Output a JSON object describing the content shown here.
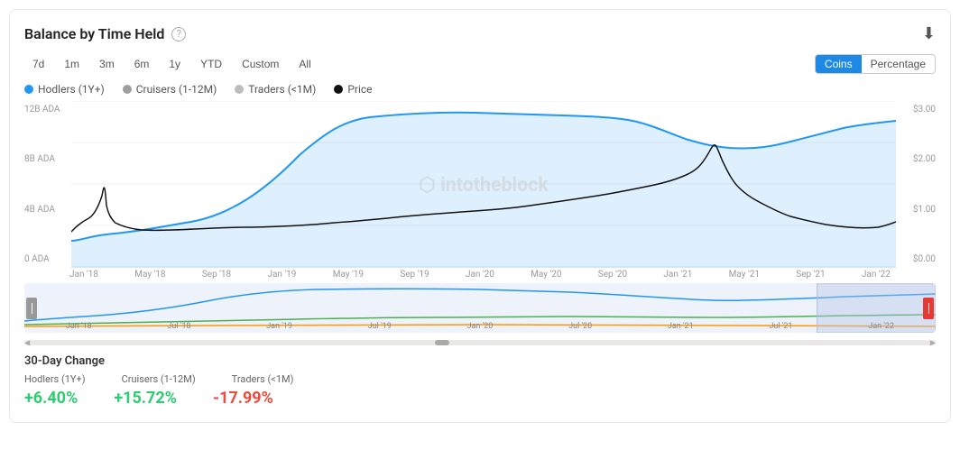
{
  "card": {
    "title": "Balance by Time Held",
    "download_label": "⬇"
  },
  "time_buttons": [
    {
      "label": "7d",
      "id": "7d"
    },
    {
      "label": "1m",
      "id": "1m"
    },
    {
      "label": "3m",
      "id": "3m"
    },
    {
      "label": "6m",
      "id": "6m"
    },
    {
      "label": "1y",
      "id": "1y"
    },
    {
      "label": "YTD",
      "id": "ytd"
    },
    {
      "label": "Custom",
      "id": "custom"
    },
    {
      "label": "All",
      "id": "all"
    }
  ],
  "view_toggle": {
    "coins_label": "Coins",
    "percentage_label": "Percentage"
  },
  "legend": [
    {
      "label": "Hodlers (1Y+)",
      "color": "#2196F3"
    },
    {
      "label": "Cruisers (1-12M)",
      "color": "#9E9E9E"
    },
    {
      "label": "Traders (<1M)",
      "color": "#BDBDBD"
    },
    {
      "label": "Price",
      "color": "#111"
    }
  ],
  "y_axis_left": [
    "12B ADA",
    "8B ADA",
    "4B ADA",
    "0 ADA"
  ],
  "y_axis_right": [
    "$3.00",
    "$2.00",
    "$1.00",
    "$0.00"
  ],
  "x_axis": [
    "Jan '18",
    "May '18",
    "Sep '18",
    "Jan '19",
    "May '19",
    "Sep '19",
    "Jan '20",
    "May '20",
    "Sep '20",
    "Jan '21",
    "May '21",
    "Sep '21",
    "Jan '22"
  ],
  "minimap_x": [
    "Jan '18",
    "Jul '18",
    "Jan '19",
    "Jul '19",
    "Jan '20",
    "Jul '20",
    "Jan '21",
    "Jul '21",
    "Jan '22"
  ],
  "watermark": "⬡ intotheblock",
  "stats": {
    "title": "30-Day Change",
    "headers": [
      "Hodlers (1Y+)",
      "Cruisers (1-12M)",
      "Traders (<1M)"
    ],
    "values": [
      "+6.40%",
      "+15.72%",
      "-17.99%"
    ],
    "types": [
      "positive",
      "positive",
      "negative"
    ]
  }
}
